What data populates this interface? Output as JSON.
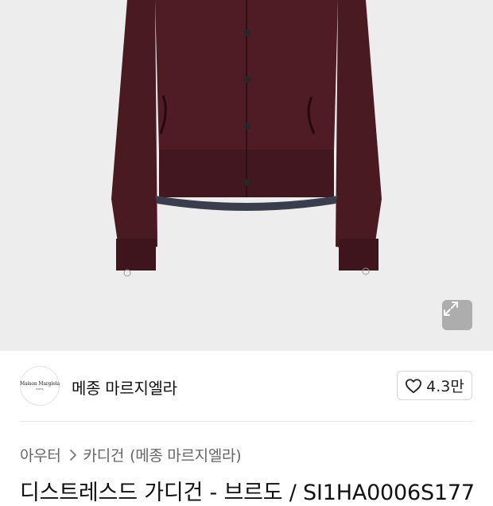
{
  "brand": {
    "logo_text": "Maison Margiela",
    "logo_subtext": "PARIS",
    "name": "메종 마르지엘라"
  },
  "like": {
    "count": "4.3만"
  },
  "breadcrumb": {
    "category": "아우터",
    "subcategory": "카디건",
    "brand_suffix": "(메종 마르지엘라)"
  },
  "product": {
    "title": "디스트레스드 가디건 - 브르도 / SI1HA0006S177"
  },
  "icons": {
    "expand": "expand-icon",
    "heart": "heart-icon",
    "chevron": "chevron-right-icon"
  },
  "colors": {
    "garment": "#4a1a22",
    "image_background": "#ededed"
  }
}
